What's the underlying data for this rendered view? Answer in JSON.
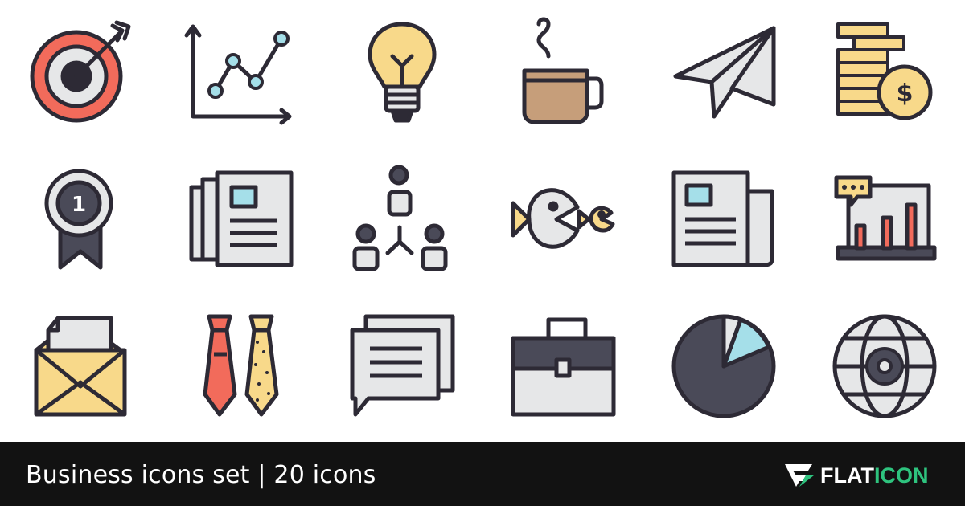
{
  "caption": "Business icons set | 20 icons",
  "brand": {
    "part1": "FLAT",
    "part2": "ICON"
  },
  "colors": {
    "outline": "#2d2a35",
    "red": "#f26b5b",
    "yellow": "#f8d98a",
    "blue": "#a5dfe9",
    "gray": "#e6e7e8",
    "brown": "#c69e7a",
    "green": "#2ec37e",
    "footer": "#121212"
  },
  "icons": [
    {
      "name": "target-icon"
    },
    {
      "name": "line-chart-icon"
    },
    {
      "name": "light-bulb-icon"
    },
    {
      "name": "coffee-cup-icon"
    },
    {
      "name": "paper-plane-icon"
    },
    {
      "name": "coins-icon"
    },
    {
      "name": "medal-icon"
    },
    {
      "name": "newspapers-icon"
    },
    {
      "name": "team-hierarchy-icon"
    },
    {
      "name": "big-fish-small-fish-icon"
    },
    {
      "name": "newspaper-icon"
    },
    {
      "name": "presentation-chart-icon"
    },
    {
      "name": "envelope-letter-icon"
    },
    {
      "name": "ties-icon"
    },
    {
      "name": "chat-bubbles-icon"
    },
    {
      "name": "briefcase-icon"
    },
    {
      "name": "pie-chart-icon"
    },
    {
      "name": "globe-gear-icon"
    }
  ]
}
